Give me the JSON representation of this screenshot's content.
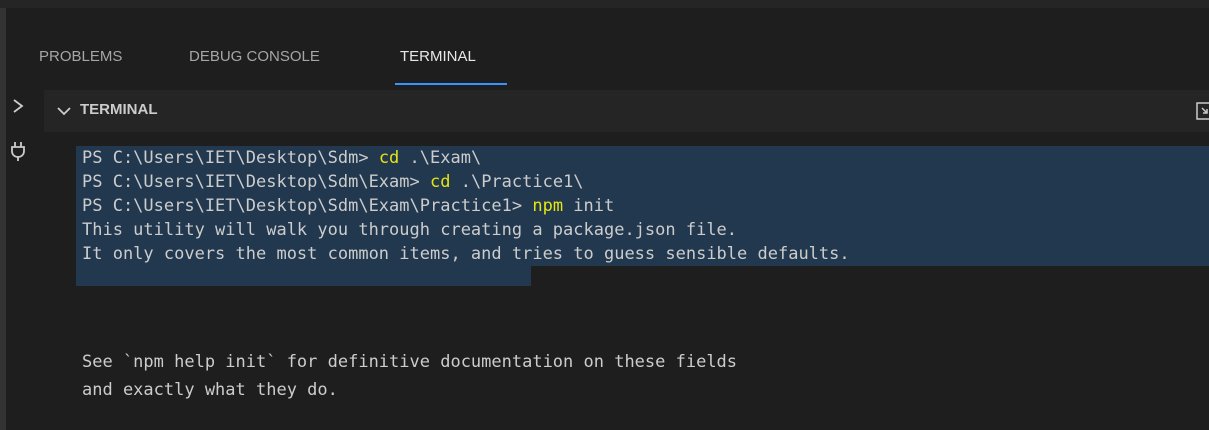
{
  "panel": {
    "tabs": [
      {
        "label": "PROBLEMS"
      },
      {
        "label": "DEBUG CONSOLE"
      },
      {
        "label": "TERMINAL",
        "active": true
      }
    ],
    "section_title": "TERMINAL"
  },
  "icons": {
    "sidebar_toggle": "chevron-right-icon",
    "plug": "plug-icon",
    "collapse": "chevron-down-icon",
    "maximize": "maximize-panel-icon"
  },
  "terminal": {
    "lines": [
      {
        "prompt": "PS C:\\Users\\IET\\Desktop\\Sdm> ",
        "cmd": "cd",
        "rest": " .\\Exam\\"
      },
      {
        "prompt": "PS C:\\Users\\IET\\Desktop\\Sdm\\Exam> ",
        "cmd": "cd",
        "rest": " .\\Practice1\\"
      },
      {
        "prompt": "PS C:\\Users\\IET\\Desktop\\Sdm\\Exam\\Practice1> ",
        "cmd": "npm",
        "rest": " init"
      },
      {
        "text": "This utility will walk you through creating a package.json file."
      },
      {
        "text": "It only covers the most common items, and tries to guess sensible defaults."
      },
      {
        "text": ""
      },
      {
        "text": "See `npm help init` for definitive documentation on these fields"
      },
      {
        "text": "and exactly what they do."
      }
    ]
  },
  "colors": {
    "background": "#1e1e1e",
    "header_background": "#252526",
    "active_tab_underline": "#3794ff",
    "selection": "#264f78",
    "command": "#e5e510",
    "text": "#cccccc"
  }
}
